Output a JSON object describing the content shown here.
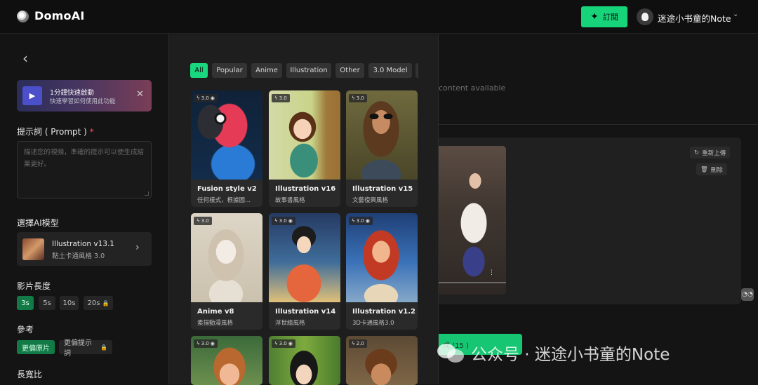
{
  "header": {
    "logo": "DomoAI",
    "subscribe_label": "訂閱",
    "user_name": "迷途小书童的Note"
  },
  "sidebar": {
    "promo": {
      "title": "1分鐘快速啟動",
      "subtitle": "快速學習如何使用此功能"
    },
    "prompt": {
      "label": "提示詞 ( Prompt )",
      "required_mark": "*",
      "placeholder": "描述您的視頻，準確的提示可以使生成結果更好。"
    },
    "model": {
      "label": "選擇AI模型",
      "name": "Illustration v13.1",
      "desc": "黏土卡通風格 3.0"
    },
    "duration": {
      "label": "影片長度",
      "options": [
        "3s",
        "5s",
        "10s",
        "20s"
      ],
      "selected": "3s",
      "locked": "20s"
    },
    "reference": {
      "label": "參考",
      "options": [
        "更偏原片",
        "更偏提示詞"
      ],
      "selected": "更偏原片"
    },
    "aspect_label": "長寬比"
  },
  "model_picker": {
    "filters": [
      "All",
      "Popular",
      "Anime",
      "Illustration",
      "Other",
      "3.0 Model"
    ],
    "selected_filter": "All",
    "cards": [
      {
        "name": "Fusion style v2",
        "desc": "任何樣式，根據圖...",
        "badge": "3.0",
        "icon": "eye-icon"
      },
      {
        "name": "Illustration v16",
        "desc": "故事書風格",
        "badge": "3.0",
        "icon": ""
      },
      {
        "name": "Illustration v15",
        "desc": "文藝復興風格",
        "badge": "3.0",
        "icon": ""
      },
      {
        "name": "Anime v8",
        "desc": "素描動漫風格",
        "badge": "3.0",
        "icon": ""
      },
      {
        "name": "Illustration v14",
        "desc": "浮世繪風格",
        "badge": "3.0",
        "icon": "eye-icon"
      },
      {
        "name": "Illustration v1.2",
        "desc": "3D卡通風格3.0",
        "badge": "3.0",
        "icon": "eye-icon"
      },
      {
        "name": "",
        "desc": "",
        "badge": "3.0",
        "icon": "eye-icon"
      },
      {
        "name": "",
        "desc": "",
        "badge": "3.0",
        "icon": "eye-icon"
      },
      {
        "name": "",
        "desc": "",
        "badge": "2.0",
        "icon": ""
      }
    ]
  },
  "main": {
    "empty_text": "content available",
    "regenerate_label": "重新上傳",
    "delete_label": "刪除",
    "generate_label": "成 (15 )"
  },
  "watermark": "公众号 · 迷途小书童的Note",
  "colors": {
    "accent": "#17d47a",
    "background": "#141414",
    "panel": "#1e1e1e"
  }
}
